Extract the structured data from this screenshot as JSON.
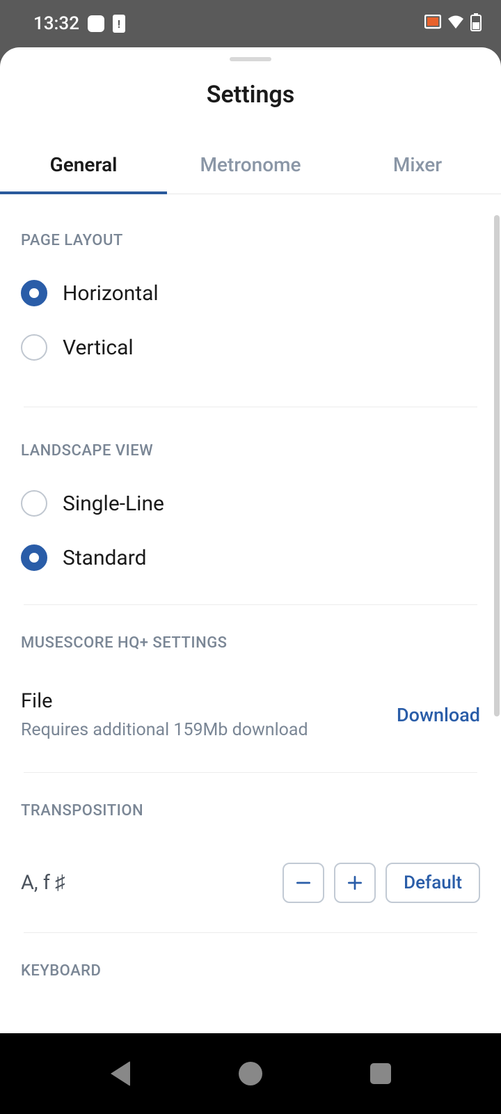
{
  "status": {
    "time": "13:32"
  },
  "title": "Settings",
  "tabs": {
    "general": "General",
    "metronome": "Metronome",
    "mixer": "Mixer"
  },
  "sections": {
    "pageLayout": {
      "header": "PAGE LAYOUT",
      "horizontal": "Horizontal",
      "vertical": "Vertical"
    },
    "landscape": {
      "header": "LANDSCAPE VIEW",
      "singleLine": "Single-Line",
      "standard": "Standard"
    },
    "hq": {
      "header": "MUSESCORE HQ+ SETTINGS",
      "title": "File",
      "sub": "Requires additional 159Mb download",
      "action": "Download"
    },
    "transposition": {
      "header": "TRANSPOSITION",
      "value": "A, f ♯",
      "defaultLabel": "Default"
    },
    "keyboard": {
      "header": "KEYBOARD"
    }
  }
}
